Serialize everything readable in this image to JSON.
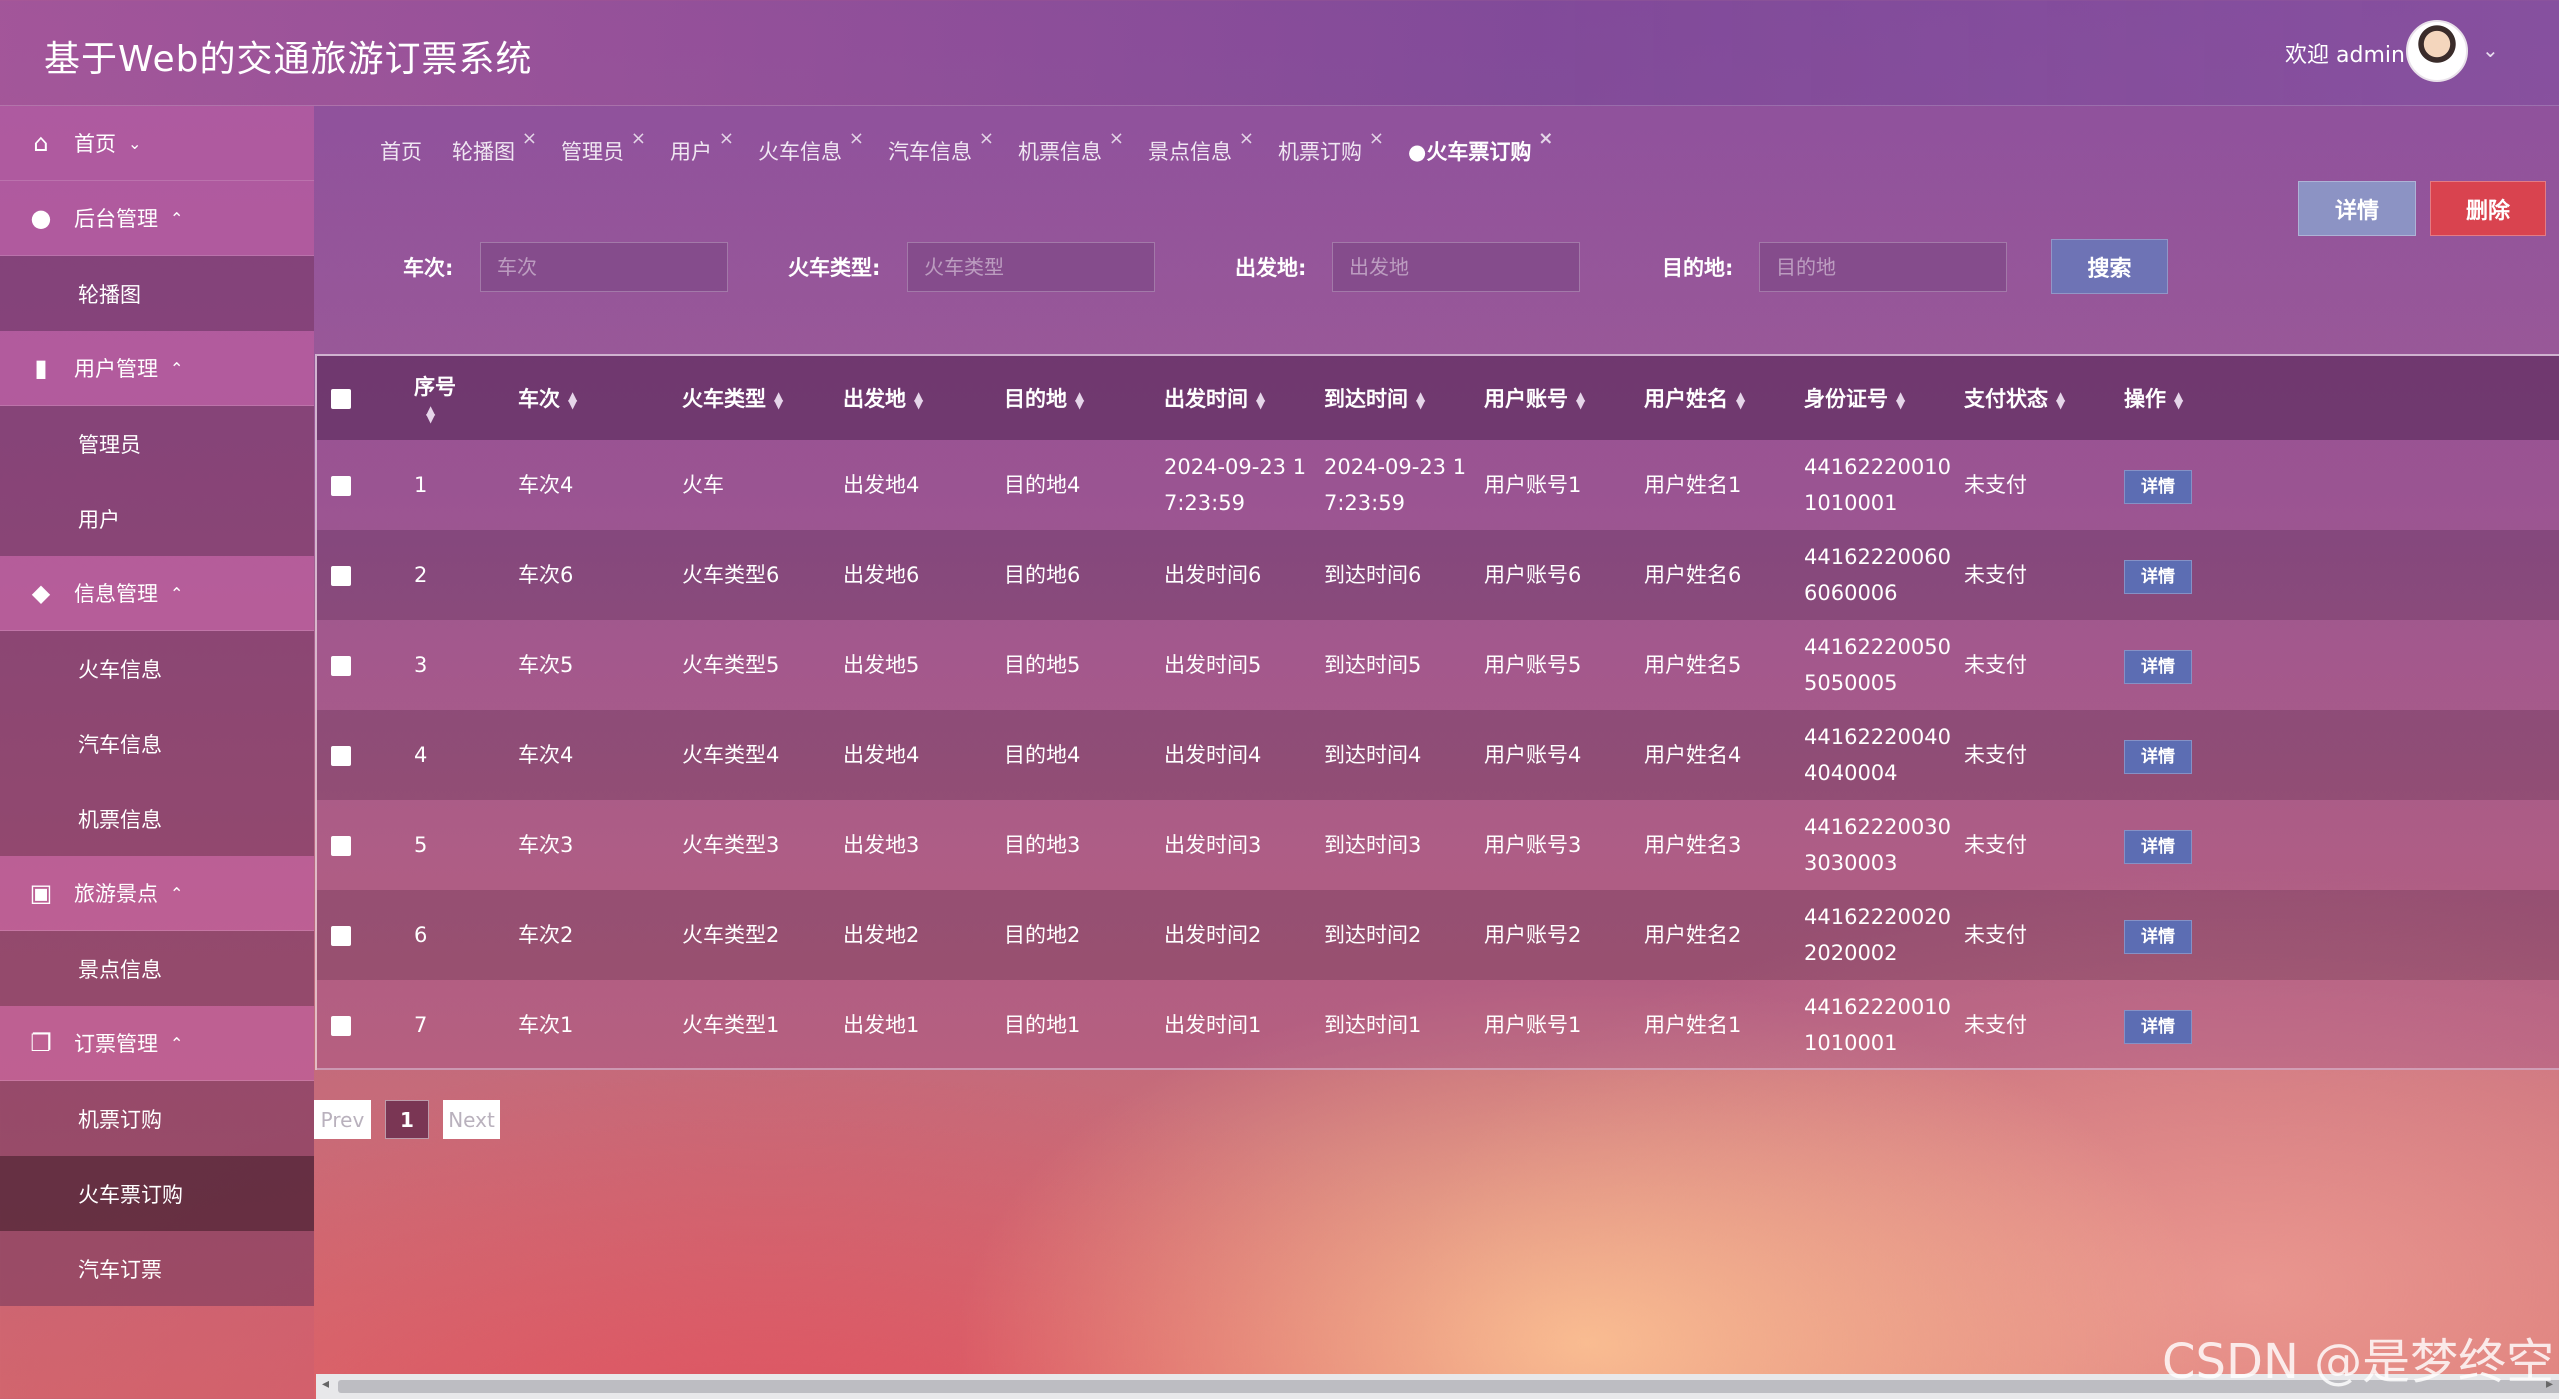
{
  "header": {
    "title": "基于Web的交通旅游订票系统",
    "welcome": "欢迎 admin",
    "avatar_icon": "user-avatar-icon",
    "dropdown_icon": "chevron-down-icon"
  },
  "sidebar": {
    "groups": [
      {
        "label": "首页",
        "icon": "home-icon",
        "caret": "⌄",
        "items": []
      },
      {
        "label": "后台管理",
        "icon": "chat-icon",
        "caret": "⌃",
        "items": [
          "轮播图"
        ]
      },
      {
        "label": "用户管理",
        "icon": "user-card-icon",
        "caret": "⌃",
        "items": [
          "管理员",
          "用户"
        ]
      },
      {
        "label": "信息管理",
        "icon": "incognito-icon",
        "caret": "⌃",
        "items": [
          "火车信息",
          "汽车信息",
          "机票信息"
        ]
      },
      {
        "label": "旅游景点",
        "icon": "chip-icon",
        "caret": "⌃",
        "items": [
          "景点信息"
        ]
      },
      {
        "label": "订票管理",
        "icon": "copy-icon",
        "caret": "⌃",
        "items": [
          "机票订购",
          "火车票订购",
          "汽车订票"
        ]
      }
    ],
    "active_item": "火车票订购"
  },
  "tabs": [
    {
      "label": "首页",
      "closable": false,
      "active": false
    },
    {
      "label": "轮播图",
      "closable": true,
      "active": false
    },
    {
      "label": "管理员",
      "closable": true,
      "active": false
    },
    {
      "label": "用户",
      "closable": true,
      "active": false
    },
    {
      "label": "火车信息",
      "closable": true,
      "active": false
    },
    {
      "label": "汽车信息",
      "closable": true,
      "active": false
    },
    {
      "label": "机票信息",
      "closable": true,
      "active": false
    },
    {
      "label": "景点信息",
      "closable": true,
      "active": false
    },
    {
      "label": "机票订购",
      "closable": true,
      "active": false
    },
    {
      "label": "●火车票订购",
      "closable": true,
      "active": true
    }
  ],
  "search": {
    "fields": [
      {
        "label": "车次:",
        "placeholder": "车次",
        "value": ""
      },
      {
        "label": "火车类型:",
        "placeholder": "火车类型",
        "value": ""
      },
      {
        "label": "出发地:",
        "placeholder": "出发地",
        "value": ""
      },
      {
        "label": "目的地:",
        "placeholder": "目的地",
        "value": ""
      }
    ],
    "button": "搜索"
  },
  "actions": {
    "detail": "详情",
    "delete": "删除"
  },
  "table": {
    "columns": [
      "序号",
      "车次",
      "火车类型",
      "出发地",
      "目的地",
      "出发时间",
      "到达时间",
      "用户账号",
      "用户姓名",
      "身份证号",
      "支付状态",
      "操作"
    ],
    "rows": [
      {
        "no": "1",
        "train": "车次4",
        "type": "火车",
        "from": "出发地4",
        "to": "目的地4",
        "depart": "2024-09-23 17:23:59",
        "arrive": "2024-09-23 17:23:59",
        "account": "用户账号1",
        "name": "用户姓名1",
        "id": "441622200101010001",
        "pay": "未支付",
        "op": "详情"
      },
      {
        "no": "2",
        "train": "车次6",
        "type": "火车类型6",
        "from": "出发地6",
        "to": "目的地6",
        "depart": "出发时间6",
        "arrive": "到达时间6",
        "account": "用户账号6",
        "name": "用户姓名6",
        "id": "441622200606060006",
        "pay": "未支付",
        "op": "详情"
      },
      {
        "no": "3",
        "train": "车次5",
        "type": "火车类型5",
        "from": "出发地5",
        "to": "目的地5",
        "depart": "出发时间5",
        "arrive": "到达时间5",
        "account": "用户账号5",
        "name": "用户姓名5",
        "id": "441622200505050005",
        "pay": "未支付",
        "op": "详情"
      },
      {
        "no": "4",
        "train": "车次4",
        "type": "火车类型4",
        "from": "出发地4",
        "to": "目的地4",
        "depart": "出发时间4",
        "arrive": "到达时间4",
        "account": "用户账号4",
        "name": "用户姓名4",
        "id": "441622200404040004",
        "pay": "未支付",
        "op": "详情"
      },
      {
        "no": "5",
        "train": "车次3",
        "type": "火车类型3",
        "from": "出发地3",
        "to": "目的地3",
        "depart": "出发时间3",
        "arrive": "到达时间3",
        "account": "用户账号3",
        "name": "用户姓名3",
        "id": "441622200303030003",
        "pay": "未支付",
        "op": "详情"
      },
      {
        "no": "6",
        "train": "车次2",
        "type": "火车类型2",
        "from": "出发地2",
        "to": "目的地2",
        "depart": "出发时间2",
        "arrive": "到达时间2",
        "account": "用户账号2",
        "name": "用户姓名2",
        "id": "441622200202020002",
        "pay": "未支付",
        "op": "详情"
      },
      {
        "no": "7",
        "train": "车次1",
        "type": "火车类型1",
        "from": "出发地1",
        "to": "目的地1",
        "depart": "出发时间1",
        "arrive": "到达时间1",
        "account": "用户账号1",
        "name": "用户姓名1",
        "id": "441622200101010001",
        "pay": "未支付",
        "op": "详情"
      }
    ]
  },
  "pagination": {
    "prev": "Prev",
    "current": "1",
    "next": "Next"
  },
  "watermark": "CSDN @是梦终空"
}
